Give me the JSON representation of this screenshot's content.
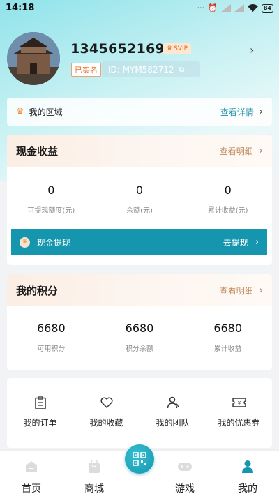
{
  "status_bar": {
    "time": "14:18",
    "battery": "84"
  },
  "profile": {
    "phone": "13456521698",
    "vip_badge": "SVIP",
    "verified": "已实名",
    "id_text": "ID: MYM582712"
  },
  "region": {
    "title": "我的区域",
    "link": "查看详情"
  },
  "cash": {
    "title": "现金收益",
    "link": "查看明细",
    "stats": [
      {
        "value": "0",
        "label": "可提现额度(元)"
      },
      {
        "value": "0",
        "label": "余额(元)"
      },
      {
        "value": "0",
        "label": "累计收益(元)"
      }
    ],
    "withdraw_title": "现金提现",
    "withdraw_link": "去提现"
  },
  "points": {
    "title": "我的积分",
    "link": "查看明细",
    "stats": [
      {
        "value": "6680",
        "label": "可用积分"
      },
      {
        "value": "6680",
        "label": "积分余额"
      },
      {
        "value": "6680",
        "label": "累计收益"
      }
    ]
  },
  "menu": [
    {
      "label": "我的订单",
      "icon": "clipboard-icon"
    },
    {
      "label": "我的收藏",
      "icon": "heart-icon"
    },
    {
      "label": "我的团队",
      "icon": "team-icon"
    },
    {
      "label": "我的优惠券",
      "icon": "coupon-icon"
    }
  ],
  "nav": [
    {
      "label": "首页",
      "icon": "home-icon"
    },
    {
      "label": "商城",
      "icon": "shopping-bag-icon"
    },
    {
      "label": "游戏",
      "icon": "gamepad-icon"
    },
    {
      "label": "我的",
      "icon": "user-icon"
    }
  ],
  "colors": {
    "accent": "#1596ae",
    "orange": "#e0702a",
    "gold_text": "#c08a5a"
  }
}
